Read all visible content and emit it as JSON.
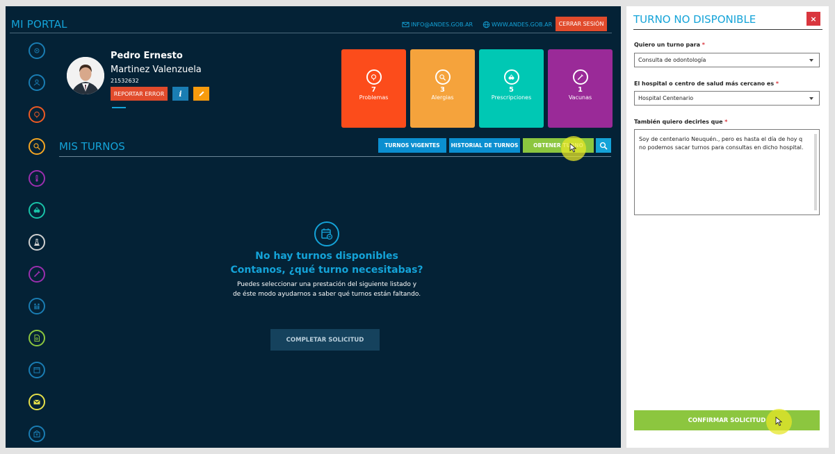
{
  "portal": {
    "title": "MI PORTAL",
    "email": "INFO@ANDES.GOB.AR",
    "website": "WWW.ANDES.GOB.AR",
    "logout_label": "CERRAR SESIÓN"
  },
  "sidebar": {
    "items": [
      {
        "icon": "summary-icon",
        "color": "#1a7db3"
      },
      {
        "icon": "patient-icon",
        "color": "#1a7db3"
      },
      {
        "icon": "problems-icon",
        "color": "#ee5a24"
      },
      {
        "icon": "allergies-icon",
        "color": "#f5a623"
      },
      {
        "icon": "thermometer-icon",
        "color": "#9b2fae"
      },
      {
        "icon": "prescriptions-icon",
        "color": "#19c3a8"
      },
      {
        "icon": "lab-icon",
        "color": "#d0d0d0"
      },
      {
        "icon": "vaccine-icon",
        "color": "#9b2fae"
      },
      {
        "icon": "family-icon",
        "color": "#1a7db3"
      },
      {
        "icon": "document-icon",
        "color": "#8cc63f"
      },
      {
        "icon": "calendar-icon",
        "color": "#1a7db3"
      },
      {
        "icon": "mail-icon",
        "color": "#e6e04a"
      },
      {
        "icon": "hospital-icon",
        "color": "#1a7db3"
      }
    ]
  },
  "user": {
    "first_name": "Pedro Ernesto",
    "last_name": "Martinez Valenzuela",
    "document": "21532632",
    "report_label": "REPORTAR ERROR",
    "info_label": "i"
  },
  "tiles": [
    {
      "count": "7",
      "label": "Problemas",
      "color": "#fc4c1b",
      "icon": "brain-icon"
    },
    {
      "count": "3",
      "label": "Alergias",
      "color": "#f5a33c",
      "icon": "magnifier-icon"
    },
    {
      "count": "5",
      "label": "Prescripciones",
      "color": "#00c8b4",
      "icon": "pills-icon"
    },
    {
      "count": "1",
      "label": "Vacunas",
      "color": "#9a2a98",
      "icon": "syringe-icon"
    }
  ],
  "turnos": {
    "title": "MIS TURNOS",
    "tab_current": "TURNOS VIGENTES",
    "tab_history": "HISTORIAL DE TURNOS",
    "tab_get": "OBTENER TURNO",
    "empty_line1": "No hay turnos disponibles",
    "empty_line2": "Contanos, ¿qué turno necesitabas?",
    "empty_desc1": "Puedes seleccionar una prestación del siguiente listado y",
    "empty_desc2": "de éste modo ayudarnos a saber qué turnos están faltando.",
    "complete_label": "COMPLETAR SOLICITUD"
  },
  "panel": {
    "title": "TURNO NO DISPONIBLE",
    "close_label": "×",
    "q1_label": "Quiero un turno para",
    "q1_value": "Consulta de odontología",
    "q2_label": "El hospital o centro de salud más cercano es",
    "q2_value": "Hospital Centenario",
    "q3_label": "También quiero decirles que",
    "q3_value": "Soy de centenario Neuquén., pero es hasta el día de hoy q no podemos sacar turnos para consultas en dicho hospital.",
    "required_mark": "*",
    "confirm_label": "CONFIRMAR SOLICITUD"
  }
}
